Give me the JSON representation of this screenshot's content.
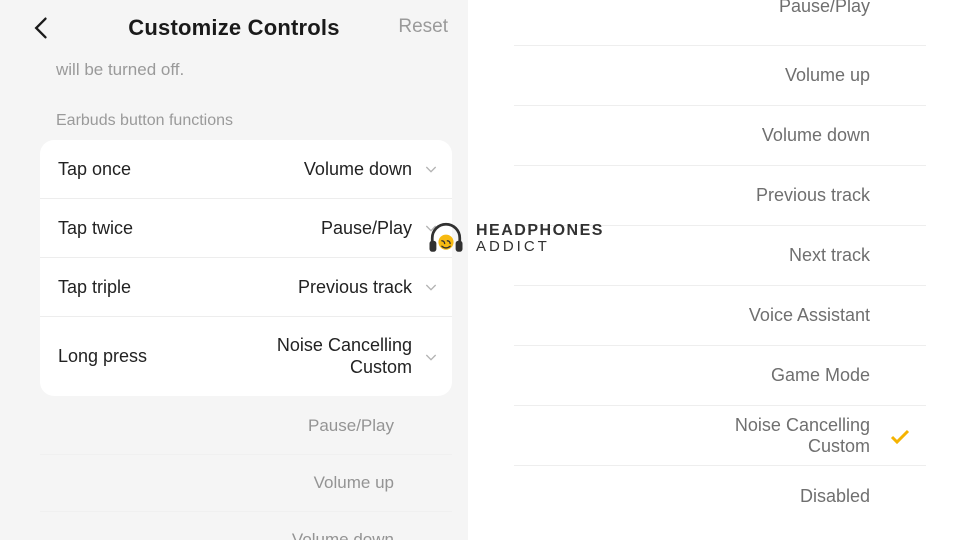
{
  "header": {
    "title": "Customize Controls",
    "reset": "Reset"
  },
  "subline": "will be turned off.",
  "section": "Earbuds button functions",
  "controls": [
    {
      "label": "Tap once",
      "value": "Volume down"
    },
    {
      "label": "Tap twice",
      "value": "Pause/Play"
    },
    {
      "label": "Tap triple",
      "value": "Previous track"
    },
    {
      "label": "Long press",
      "value": "Noise Cancelling Custom"
    }
  ],
  "left_sub": {
    "a": "Pause/Play",
    "b": "Volume up",
    "c": "Volume down"
  },
  "options": [
    {
      "label": "Pause/Play",
      "selected": false
    },
    {
      "label": "Volume up",
      "selected": false
    },
    {
      "label": "Volume down",
      "selected": false
    },
    {
      "label": "Previous track",
      "selected": false
    },
    {
      "label": "Next track",
      "selected": false
    },
    {
      "label": "Voice Assistant",
      "selected": false
    },
    {
      "label": "Game Mode",
      "selected": false
    },
    {
      "label": "Noise Cancelling Custom",
      "selected": true
    },
    {
      "label": "Disabled",
      "selected": false
    }
  ],
  "watermark": {
    "line1": "HEADPHONES",
    "line2": "ADDICT"
  }
}
